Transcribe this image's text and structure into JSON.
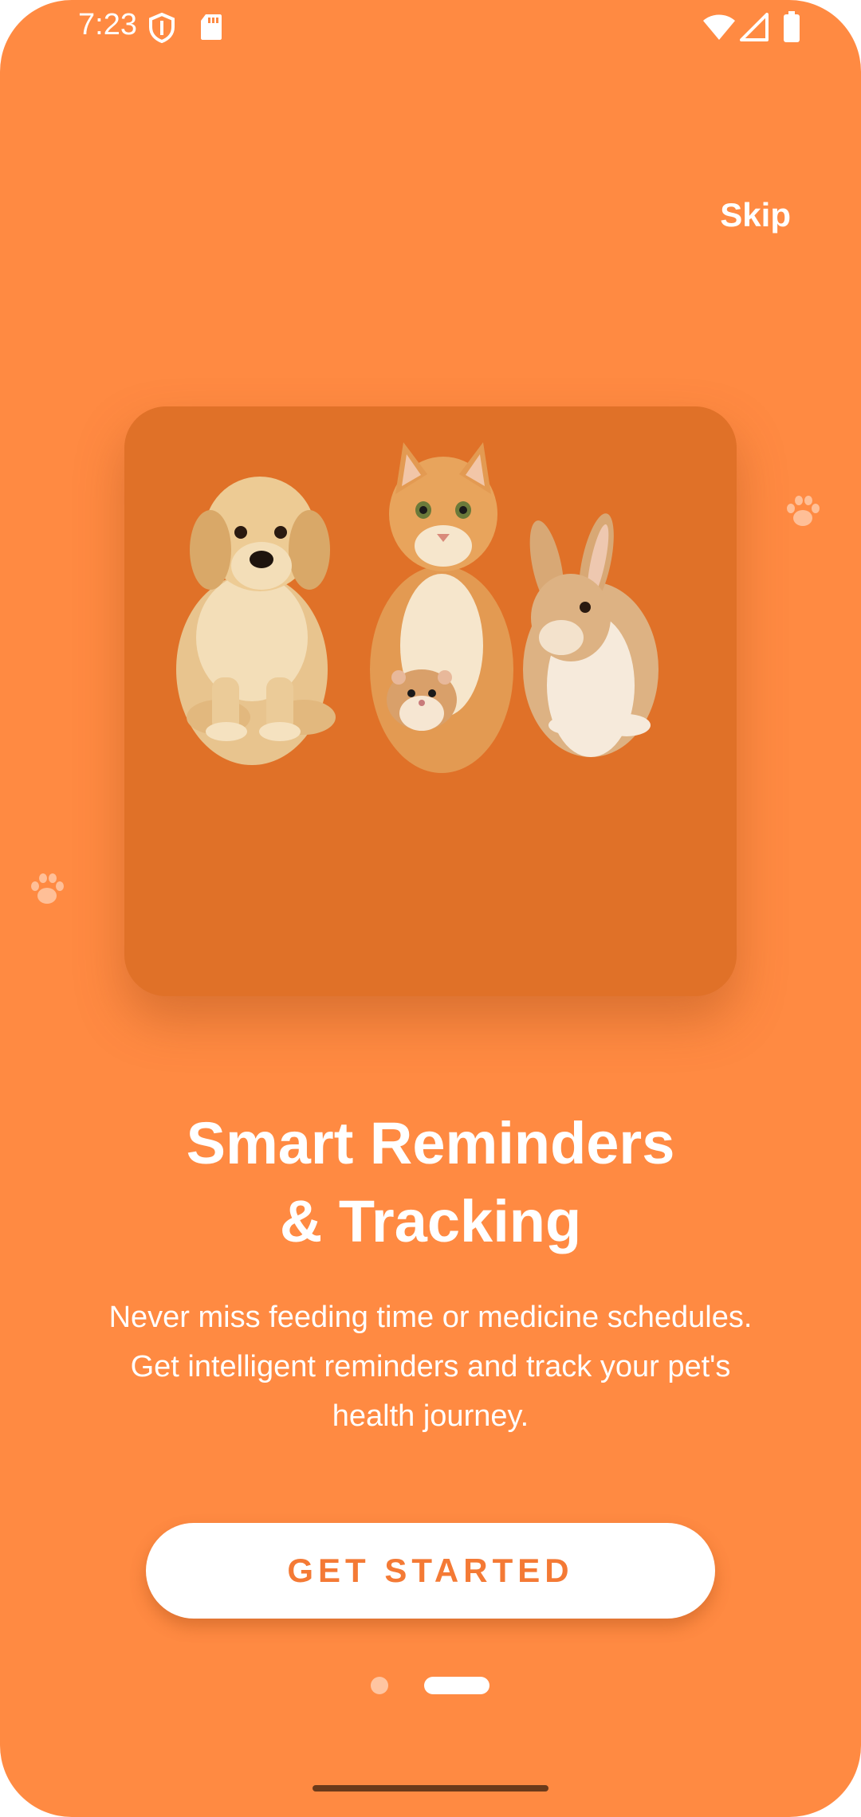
{
  "status_bar": {
    "time": "7:23",
    "icons": [
      "shield-icon",
      "sd-card-icon",
      "wifi-icon",
      "cell-signal-icon",
      "battery-icon"
    ]
  },
  "header": {
    "skip_label": "Skip"
  },
  "hero": {
    "image": "dog-cat-hamster-rabbit-illustration"
  },
  "content": {
    "title_line1": "Smart Reminders",
    "title_line2": "& Tracking",
    "description_line1": "Never miss feeding time or medicine schedules.",
    "description_line2": "Get intelligent reminders and track your pet's",
    "description_line3": "health journey."
  },
  "cta": {
    "label": "GET STARTED"
  },
  "pager": {
    "page_count": 2,
    "current_page": 2
  },
  "colors": {
    "background": "#FF8A42",
    "card": "#E07128",
    "accent_text": "#F47A35",
    "white": "#FFFFFF"
  }
}
